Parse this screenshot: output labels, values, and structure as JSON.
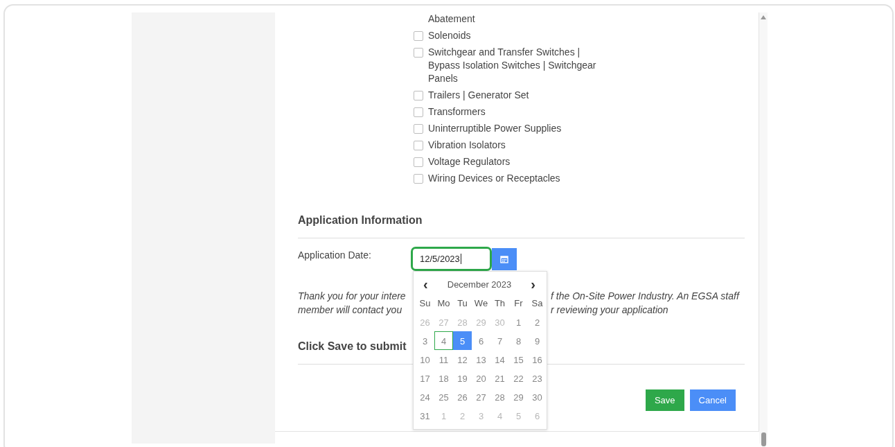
{
  "equipment_list": [
    {
      "label": "Abatement",
      "kind": "continuation"
    },
    {
      "label": "Solenoids",
      "kind": "checkbox",
      "checked": false
    },
    {
      "label": "Switchgear and Transfer Switches | Bypass Isolation Switches | Switchgear Panels",
      "kind": "checkbox",
      "checked": false
    },
    {
      "label": "Trailers | Generator Set",
      "kind": "checkbox",
      "checked": false
    },
    {
      "label": "Transformers",
      "kind": "checkbox",
      "checked": false
    },
    {
      "label": "Uninterruptible Power Supplies",
      "kind": "checkbox",
      "checked": false
    },
    {
      "label": "Vibration Isolators",
      "kind": "checkbox",
      "checked": false
    },
    {
      "label": "Voltage Regulators",
      "kind": "checkbox",
      "checked": false
    },
    {
      "label": "Wiring Devices or Receptacles",
      "kind": "checkbox",
      "checked": false
    }
  ],
  "application_section": {
    "heading": "Application Information",
    "date_label": "Application Date:",
    "date_value": "12/5/2023"
  },
  "note_lines": [
    {
      "left": "Thank you for your intere",
      "right": "f the On-Site Power Industry. An EGSA staff"
    },
    {
      "left": "member will contact you",
      "right": "r reviewing your application"
    }
  ],
  "submit_heading": "Click Save to submit",
  "calendar": {
    "prev": "‹",
    "month": "December 2023",
    "next": "›",
    "weekdays": [
      "Su",
      "Mo",
      "Tu",
      "We",
      "Th",
      "Fr",
      "Sa"
    ],
    "weeks": [
      [
        {
          "day": "26",
          "other_month": true,
          "today": false,
          "selected": false
        },
        {
          "day": "27",
          "other_month": true,
          "today": false,
          "selected": false
        },
        {
          "day": "28",
          "other_month": true,
          "today": false,
          "selected": false
        },
        {
          "day": "29",
          "other_month": true,
          "today": false,
          "selected": false
        },
        {
          "day": "30",
          "other_month": true,
          "today": false,
          "selected": false
        },
        {
          "day": "1",
          "other_month": false,
          "today": false,
          "selected": false
        },
        {
          "day": "2",
          "other_month": false,
          "today": false,
          "selected": false
        }
      ],
      [
        {
          "day": "3",
          "other_month": false,
          "today": false,
          "selected": false
        },
        {
          "day": "4",
          "other_month": false,
          "today": true,
          "selected": false
        },
        {
          "day": "5",
          "other_month": false,
          "today": false,
          "selected": true
        },
        {
          "day": "6",
          "other_month": false,
          "today": false,
          "selected": false
        },
        {
          "day": "7",
          "other_month": false,
          "today": false,
          "selected": false
        },
        {
          "day": "8",
          "other_month": false,
          "today": false,
          "selected": false
        },
        {
          "day": "9",
          "other_month": false,
          "today": false,
          "selected": false
        }
      ],
      [
        {
          "day": "10",
          "other_month": false,
          "today": false,
          "selected": false
        },
        {
          "day": "11",
          "other_month": false,
          "today": false,
          "selected": false
        },
        {
          "day": "12",
          "other_month": false,
          "today": false,
          "selected": false
        },
        {
          "day": "13",
          "other_month": false,
          "today": false,
          "selected": false
        },
        {
          "day": "14",
          "other_month": false,
          "today": false,
          "selected": false
        },
        {
          "day": "15",
          "other_month": false,
          "today": false,
          "selected": false
        },
        {
          "day": "16",
          "other_month": false,
          "today": false,
          "selected": false
        }
      ],
      [
        {
          "day": "17",
          "other_month": false,
          "today": false,
          "selected": false
        },
        {
          "day": "18",
          "other_month": false,
          "today": false,
          "selected": false
        },
        {
          "day": "19",
          "other_month": false,
          "today": false,
          "selected": false
        },
        {
          "day": "20",
          "other_month": false,
          "today": false,
          "selected": false
        },
        {
          "day": "21",
          "other_month": false,
          "today": false,
          "selected": false
        },
        {
          "day": "22",
          "other_month": false,
          "today": false,
          "selected": false
        },
        {
          "day": "23",
          "other_month": false,
          "today": false,
          "selected": false
        }
      ],
      [
        {
          "day": "24",
          "other_month": false,
          "today": false,
          "selected": false
        },
        {
          "day": "25",
          "other_month": false,
          "today": false,
          "selected": false
        },
        {
          "day": "26",
          "other_month": false,
          "today": false,
          "selected": false
        },
        {
          "day": "27",
          "other_month": false,
          "today": false,
          "selected": false
        },
        {
          "day": "28",
          "other_month": false,
          "today": false,
          "selected": false
        },
        {
          "day": "29",
          "other_month": false,
          "today": false,
          "selected": false
        },
        {
          "day": "30",
          "other_month": false,
          "today": false,
          "selected": false
        }
      ],
      [
        {
          "day": "31",
          "other_month": false,
          "today": false,
          "selected": false
        },
        {
          "day": "1",
          "other_month": true,
          "today": false,
          "selected": false
        },
        {
          "day": "2",
          "other_month": true,
          "today": false,
          "selected": false
        },
        {
          "day": "3",
          "other_month": true,
          "today": false,
          "selected": false
        },
        {
          "day": "4",
          "other_month": true,
          "today": false,
          "selected": false
        },
        {
          "day": "5",
          "other_month": true,
          "today": false,
          "selected": false
        },
        {
          "day": "6",
          "other_month": true,
          "today": false,
          "selected": false
        }
      ]
    ]
  },
  "buttons": [
    {
      "label": "Save",
      "kind": "primary"
    },
    {
      "label": "Cancel",
      "kind": "secondary"
    }
  ]
}
